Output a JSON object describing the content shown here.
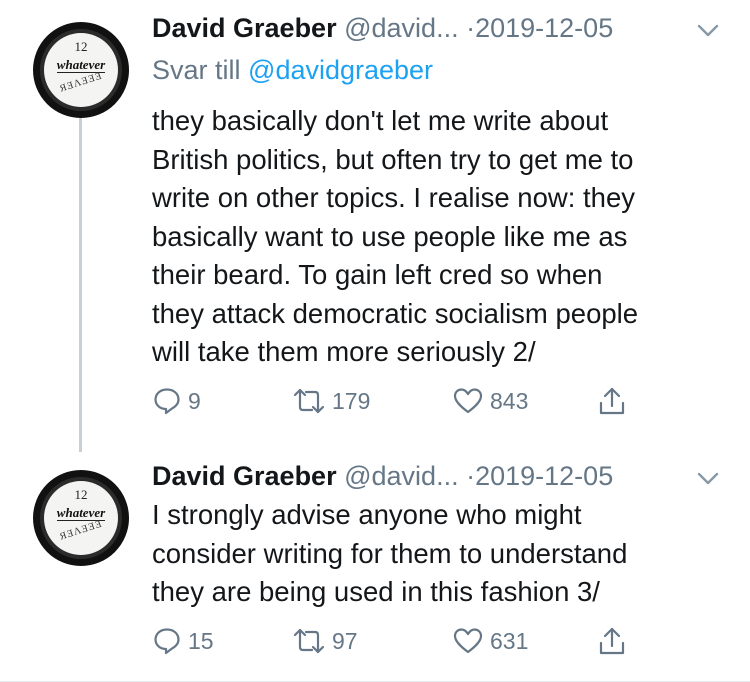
{
  "tweets": [
    {
      "author_name": "David Graeber",
      "author_handle": "@david...",
      "separator": "·",
      "date": "2019-12-05",
      "reply_label": "Svar till",
      "reply_mention": "@davidgraeber",
      "body_lines": [
        "they basically don't let me write about",
        "British politics, but often try to get me to",
        "write on other topics. I realise now: they",
        "basically want to use people like me as",
        "their beard. To gain left cred so when",
        "they attack democratic socialism people",
        "will take them more seriously 2/"
      ],
      "replies": "9",
      "retweets": "179",
      "likes": "843"
    },
    {
      "author_name": "David Graeber",
      "author_handle": "@david...",
      "separator": "·",
      "date": "2019-12-05",
      "body_lines": [
        "I strongly advise anyone who might",
        "consider writing for them to understand",
        "they are being used in this fashion 3/"
      ],
      "replies": "15",
      "retweets": "97",
      "likes": "631"
    }
  ],
  "avatar": {
    "clock_number": "12",
    "clock_word": "whatever",
    "clock_scribble": "ЯƎΛƎƎƎ"
  },
  "icons": {
    "reply": "reply-icon",
    "retweet": "retweet-icon",
    "like": "heart-icon",
    "share": "share-icon",
    "menu": "chevron-down-icon"
  },
  "colors": {
    "text": "#14171a",
    "secondary": "#657786",
    "link": "#1da1f2",
    "thread_line": "#c8d0d6"
  }
}
